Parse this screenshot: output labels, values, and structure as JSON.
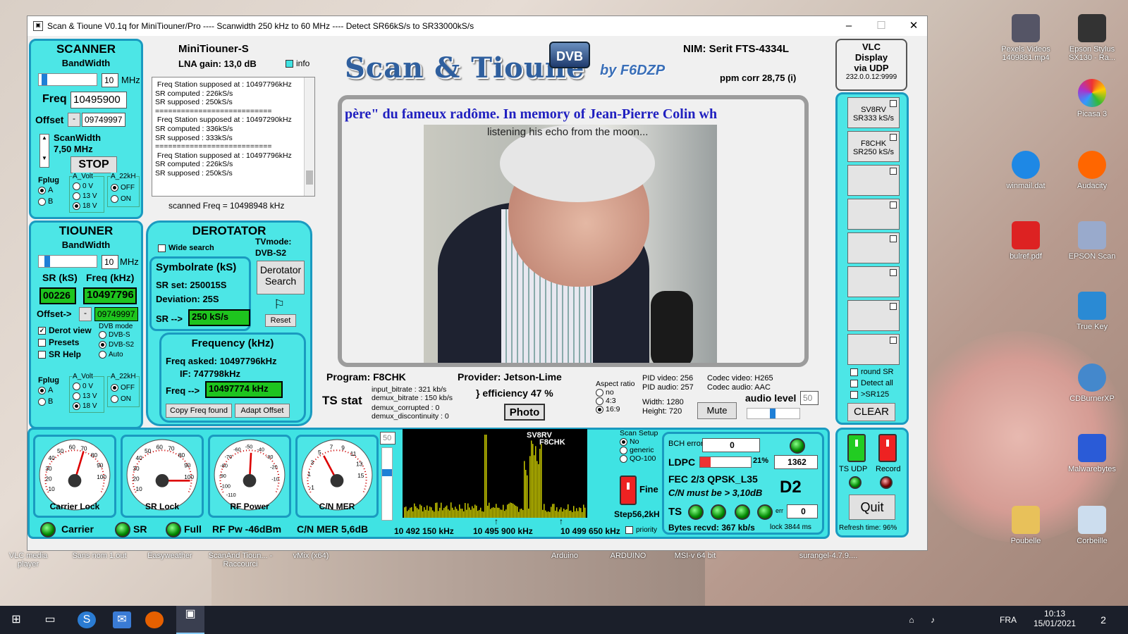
{
  "window": {
    "title": "Scan & Tioune V0.1q for MiniTiouner/Pro ---- Scanwidth 250 kHz to 60 MHz ---- Detect SR66kS/s to SR33000kS/s"
  },
  "scanner": {
    "title": "SCANNER",
    "bandwidth_label": "BandWidth",
    "bw_value": "10",
    "bw_unit": "MHz",
    "freq_label": "Freq",
    "freq_value": "10495900",
    "offset_label": "Offset",
    "offset_sign": "-",
    "offset_value": "09749997",
    "scanwidth_label": "ScanWidth",
    "scanwidth_value": "7,50 MHz",
    "stop_label": "STOP",
    "fplug_label": "Fplug",
    "fplug_a": "A",
    "fplug_b": "B",
    "avolt_label": "A_Volt",
    "v0": "0 V",
    "v13": "13 V",
    "v18": "18 V",
    "a22_label": "A_22kH",
    "off": "OFF",
    "on": "ON"
  },
  "tiouner": {
    "title": "TIOUNER",
    "bandwidth_label": "BandWidth",
    "bw_value": "10",
    "bw_unit": "MHz",
    "sr_label": "SR (kS)",
    "freq_label": "Freq (kHz)",
    "sr_value": "00226",
    "freq_value": "10497796",
    "offset_label": "Offset->",
    "offset_sign": "-",
    "offset_value": "09749997",
    "derot_view": "Derot view",
    "presets": "Presets",
    "sr_help": "SR Help",
    "dvb_mode": "DVB mode",
    "dvbs": "DVB-S",
    "dvbs2": "DVB-S2",
    "auto": "Auto",
    "fplug_label": "Fplug",
    "fplug_a": "A",
    "fplug_b": "B",
    "avolt_label": "A_Volt",
    "v0": "0 V",
    "v13": "13 V",
    "v18": "18 V",
    "a22_label": "A_22kH",
    "off": "OFF",
    "on": "ON"
  },
  "nim": {
    "device": "MiniTiouner-S",
    "lna": "LNA gain: 13,0 dB",
    "info": "info",
    "nim_label": "NIM: Serit FTS-4334L",
    "ppm": "ppm corr   28,75 (i)",
    "scanned": "scanned Freq =     10498948 kHz"
  },
  "log": {
    "text": " Freq Station supposed at : 10497796kHz\nSR computed : 226kS/s\nSR supposed : 250kS/s\n===========================\n Freq Station supposed at : 10497290kHz\nSR computed : 336kS/s\nSR supposed : 333kS/s\n===========================\n Freq Station supposed at : 10497796kHz\nSR computed : 226kS/s\nSR supposed : 250kS/s"
  },
  "logo": {
    "main": "Scan & Tioune",
    "badge": "DVB",
    "by": "by F6DZP"
  },
  "vlc": {
    "l1": "VLC",
    "l2": "Display",
    "l3": "via UDP",
    "addr": "232.0.0.12:9999"
  },
  "video": {
    "ticker": "père\" du fameux radôme.  In memory of Jean-Pierre Colin wh",
    "caption": "listening his echo from the moon..."
  },
  "derotator": {
    "title": "DEROTATOR",
    "wide_search": "Wide search",
    "tvmode_label": "TVmode:",
    "tvmode": "DVB-S2",
    "sym_title": "Symbolrate (kS)",
    "sr_set": "SR set:  250015S",
    "deviation": "Deviation:  25S",
    "sr_arrow": "SR -->",
    "sr_value": "250 kS/s",
    "derot_btn1": "Derotator",
    "derot_btn2": "Search",
    "reset": "Reset",
    "freq_title": "Frequency (kHz)",
    "freq_asked": "Freq asked:  10497796kHz",
    "if": "IF:        747798kHz",
    "freq_arrow": "Freq -->",
    "freq_value": "10497774 kHz",
    "copy_btn": "Copy Freq found",
    "adapt_btn": "Adapt Offset"
  },
  "program": {
    "program": "Program: F8CHK",
    "provider": "Provider: Jetson-Lime",
    "ts_stat": "TS stat",
    "input_bitrate": "input_bitrate :  321 kb/s",
    "demux_bitrate": "demux_bitrate :  150 kb/s",
    "demux_corrupted": "demux_corrupted :  0",
    "demux_discontinuity": "demux_discontinuity :  0",
    "efficiency": "} efficiency  47 %",
    "photo": "Photo",
    "aspect_label": "Aspect ratio",
    "aspect_no": "no",
    "aspect_43": "4:3",
    "aspect_169": "16:9",
    "pid_video": "PID video:  256",
    "pid_audio": "PID audio:  257",
    "codec_video": "Codec video:  H265",
    "codec_audio": "Codec audio:  AAC",
    "width": "Width:    1280",
    "height": "Height:   720",
    "mute": "Mute",
    "audio_level": "audio level",
    "audio_value": "50"
  },
  "stations": {
    "items": [
      {
        "l1": "SV8RV",
        "l2": "SR333 kS/s"
      },
      {
        "l1": "F8CHK",
        "l2": "SR250 kS/s"
      },
      {
        "l1": "",
        "l2": ""
      },
      {
        "l1": "",
        "l2": ""
      },
      {
        "l1": "",
        "l2": ""
      },
      {
        "l1": "",
        "l2": ""
      },
      {
        "l1": "",
        "l2": ""
      },
      {
        "l1": "",
        "l2": ""
      }
    ],
    "round_sr": "round SR",
    "detect_all": "Detect all",
    "gt_sr125": ">SR125",
    "clear": "CLEAR"
  },
  "gauges": {
    "carrier": "Carrier Lock",
    "sr": "SR Lock",
    "rf": "RF Power",
    "cn": "C/N MER",
    "carrier_st": "Carrier",
    "sr_st": "SR",
    "full_st": "Full",
    "rf_pw": "RF Pw -46dBm",
    "cn_mer": "C/N MER 5,6dB",
    "g1_ticks": [
      "10",
      "20",
      "30",
      "40",
      "50",
      "60",
      "70",
      "80",
      "90",
      "100"
    ],
    "g3_ticks": [
      "-110",
      "-100",
      "-90",
      "-80",
      "-70",
      "-60",
      "-50",
      "-40",
      "-30",
      "-20",
      "-10"
    ],
    "g4_ticks": [
      "-1",
      "1",
      "3",
      "5",
      "7",
      "9",
      "11",
      "13",
      "15"
    ]
  },
  "spectrum": {
    "slider": "50",
    "label1": "SV8RV",
    "label2": "F8CHK",
    "f1": "10 492 150 kHz",
    "f2": "10 495 900 kHz",
    "f3": "10 499 650 kHz"
  },
  "scan_setup": {
    "title": "Scan Setup",
    "no": "No",
    "generic": "generic",
    "qo100": "QO-100",
    "fine": "Fine",
    "step": "Step56,2kH",
    "priority": "priority"
  },
  "status": {
    "bch_label": "BCH errors",
    "bch": "0",
    "ldpc_label": "LDPC",
    "ldpc_pct": "21%",
    "ldpc_val": "1362",
    "fec": "FEC  2/3 QPSK_L35",
    "cn_must": "C/N must be > 3,10dB",
    "d2": "D2",
    "ts": "TS",
    "err_label": "err",
    "err": "0",
    "bytes": "Bytes recvd: 367 kb/s",
    "lock": "lock  3844 ms"
  },
  "controls": {
    "ts_udp": "TS UDP",
    "record": "Record",
    "quit": "Quit",
    "refresh": "Refresh time:  96%"
  },
  "desktop": {
    "icons": [
      {
        "label": "Pexels Videos 1409881.mp4"
      },
      {
        "label": "Epson Stylus SX130 - Ra..."
      },
      {
        "label": "Picasa 3"
      },
      {
        "label": "winmail.dat"
      },
      {
        "label": "Audacity"
      },
      {
        "label": "bulref.pdf"
      },
      {
        "label": "EPSON Scan"
      },
      {
        "label": "True Key"
      },
      {
        "label": "CDBurnerXP"
      },
      {
        "label": "Malwarebytes"
      },
      {
        "label": "Poubelle"
      },
      {
        "label": "Corbeille"
      }
    ],
    "bottom_labels": [
      "VLC media player",
      "Sans nom 1.out",
      "Easyweather",
      "ScanAnd Tioun... - Raccourci",
      "vMix (x64)",
      "Arduino",
      "ARDUINO",
      "MSI-v 64 bit",
      "surangel-4.7.9...."
    ]
  },
  "taskbar": {
    "lang": "FRA",
    "time": "10:13",
    "date": "15/01/2021",
    "notif": "2"
  }
}
